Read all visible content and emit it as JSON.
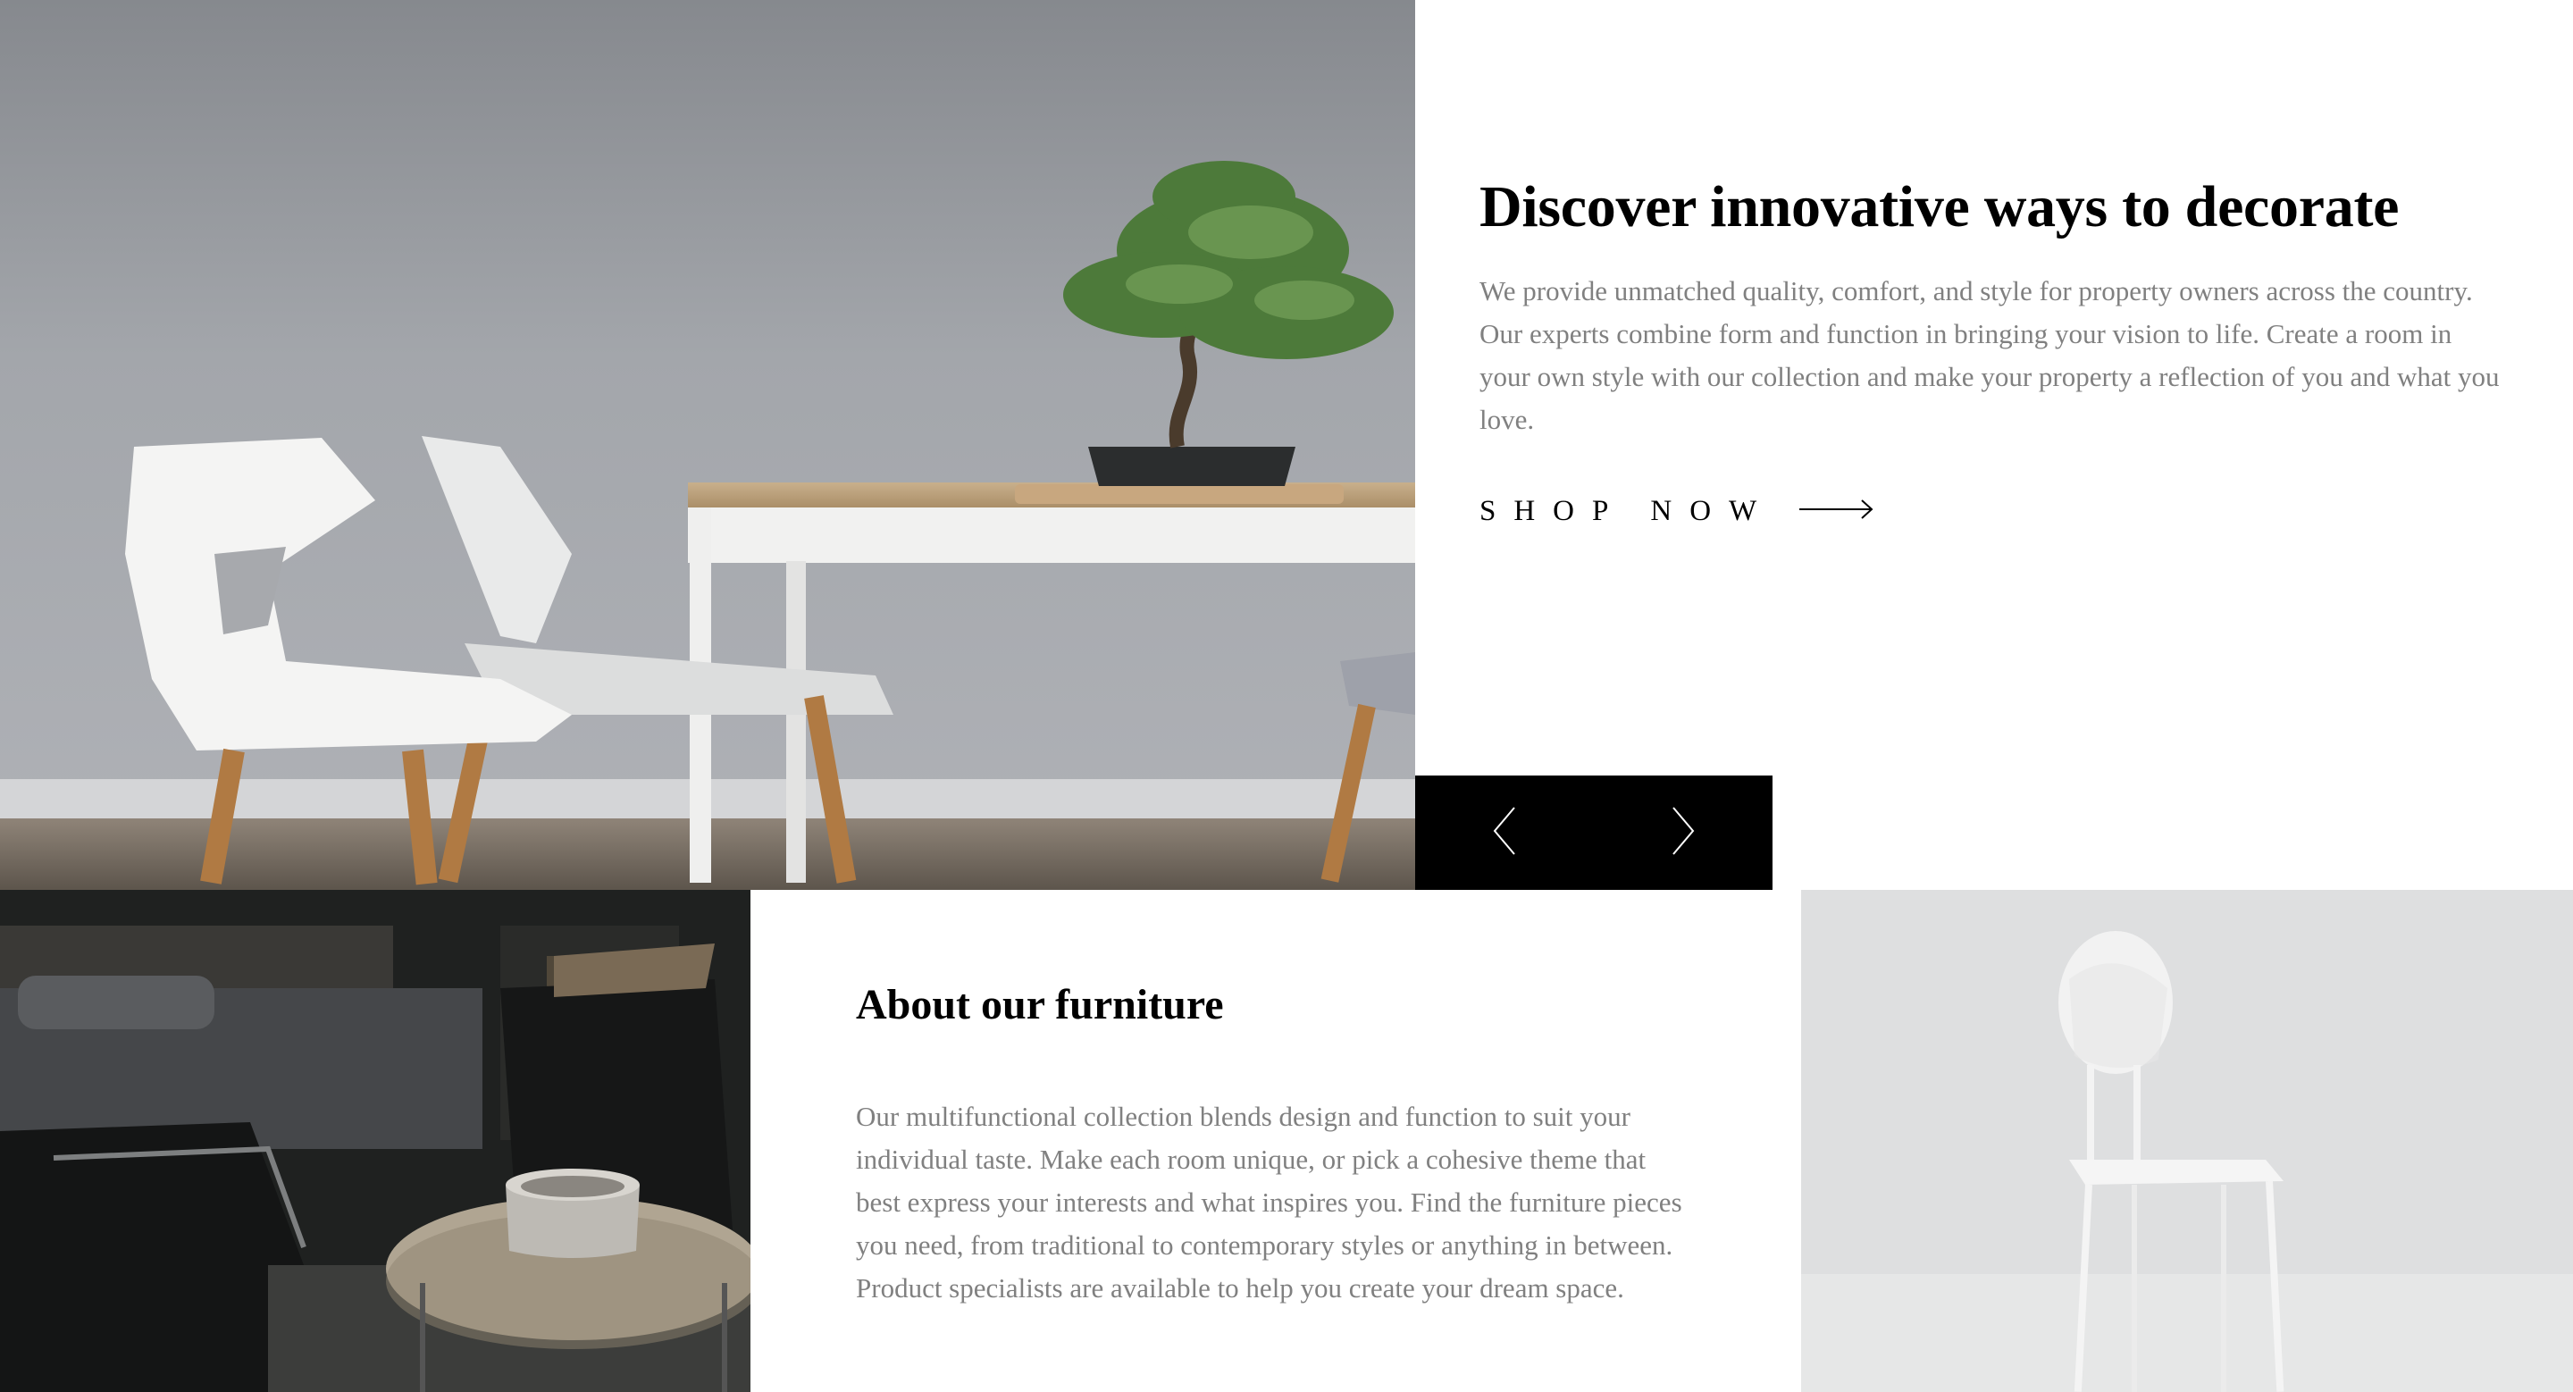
{
  "hero": {
    "title": "Discover innovative ways to decorate",
    "text": "We provide unmatched quality, comfort, and style for property owners across the country. Our experts combine form and function in bringing your vision to life. Create a room in your own style with our collection and make your property a reflection of you and what you love.",
    "cta_label": "SHOP NOW",
    "cta_icon": "long-arrow-right-icon"
  },
  "slider": {
    "prev_icon": "chevron-left-icon",
    "next_icon": "chevron-right-icon",
    "background": "#000000"
  },
  "about": {
    "title": "About our furniture",
    "text": "Our multifunctional collection blends design and function to suit your individual taste. Make each room unique, or pick a cohesive theme that best express your interests and what inspires you. Find the furniture pieces you need, from traditional to contemporary styles or anything in between. Product specialists are available to help you create your dream space."
  },
  "colors": {
    "heading": "#000000",
    "body_text": "#808080",
    "background": "#ffffff"
  }
}
